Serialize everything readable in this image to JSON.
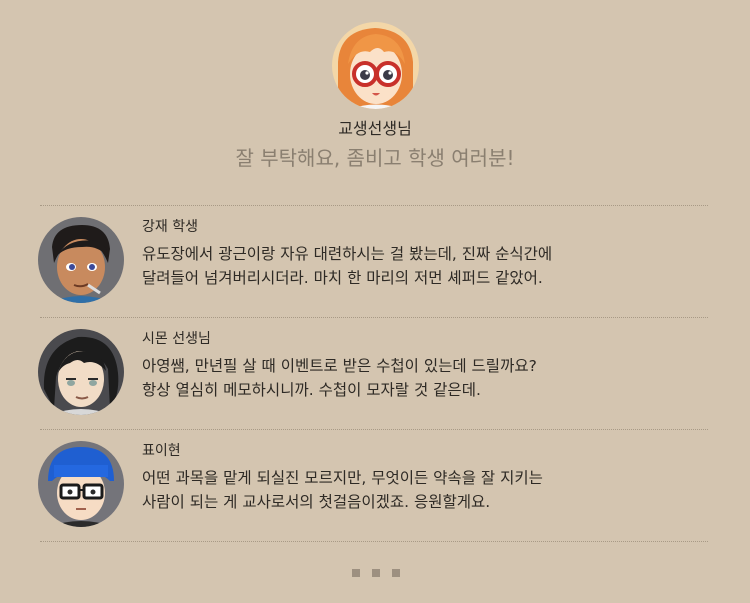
{
  "header": {
    "teacher_name": "교생선생님",
    "greeting": "잘 부탁해요, 좀비고 학생 여러분!",
    "avatar_icon": "teacher-portrait"
  },
  "comments": [
    {
      "author": "강재 학생",
      "lines": [
        "유도장에서 광근이랑 자유 대련하시는 걸 봤는데, 진짜 순식간에",
        "달려들어 넘겨버리시더라. 마치 한 마리의 저먼 셰퍼드 같았어."
      ],
      "avatar_icon": "student-kangjae-portrait"
    },
    {
      "author": "시몬 선생님",
      "lines": [
        "아영쌤, 만년필 살 때 이벤트로 받은 수첩이 있는데 드릴까요?",
        "항상 열심히 메모하시니까. 수첩이 모자랄 것 같은데."
      ],
      "avatar_icon": "teacher-simon-portrait"
    },
    {
      "author": "표이현",
      "lines": [
        "어떤 과목을 맡게 되실진 모르지만, 무엇이든 약속을 잘 지키는",
        "사람이 되는 게 교사로서의 첫걸음이겠죠. 응원할게요."
      ],
      "avatar_icon": "student-pyoihyun-portrait"
    }
  ],
  "more_indicator_icon": "ellipsis-icon",
  "colors": {
    "background": "#d4c5b0",
    "text": "#2e2a25",
    "muted_text": "#8a7f70",
    "divider": "#a89a86"
  }
}
